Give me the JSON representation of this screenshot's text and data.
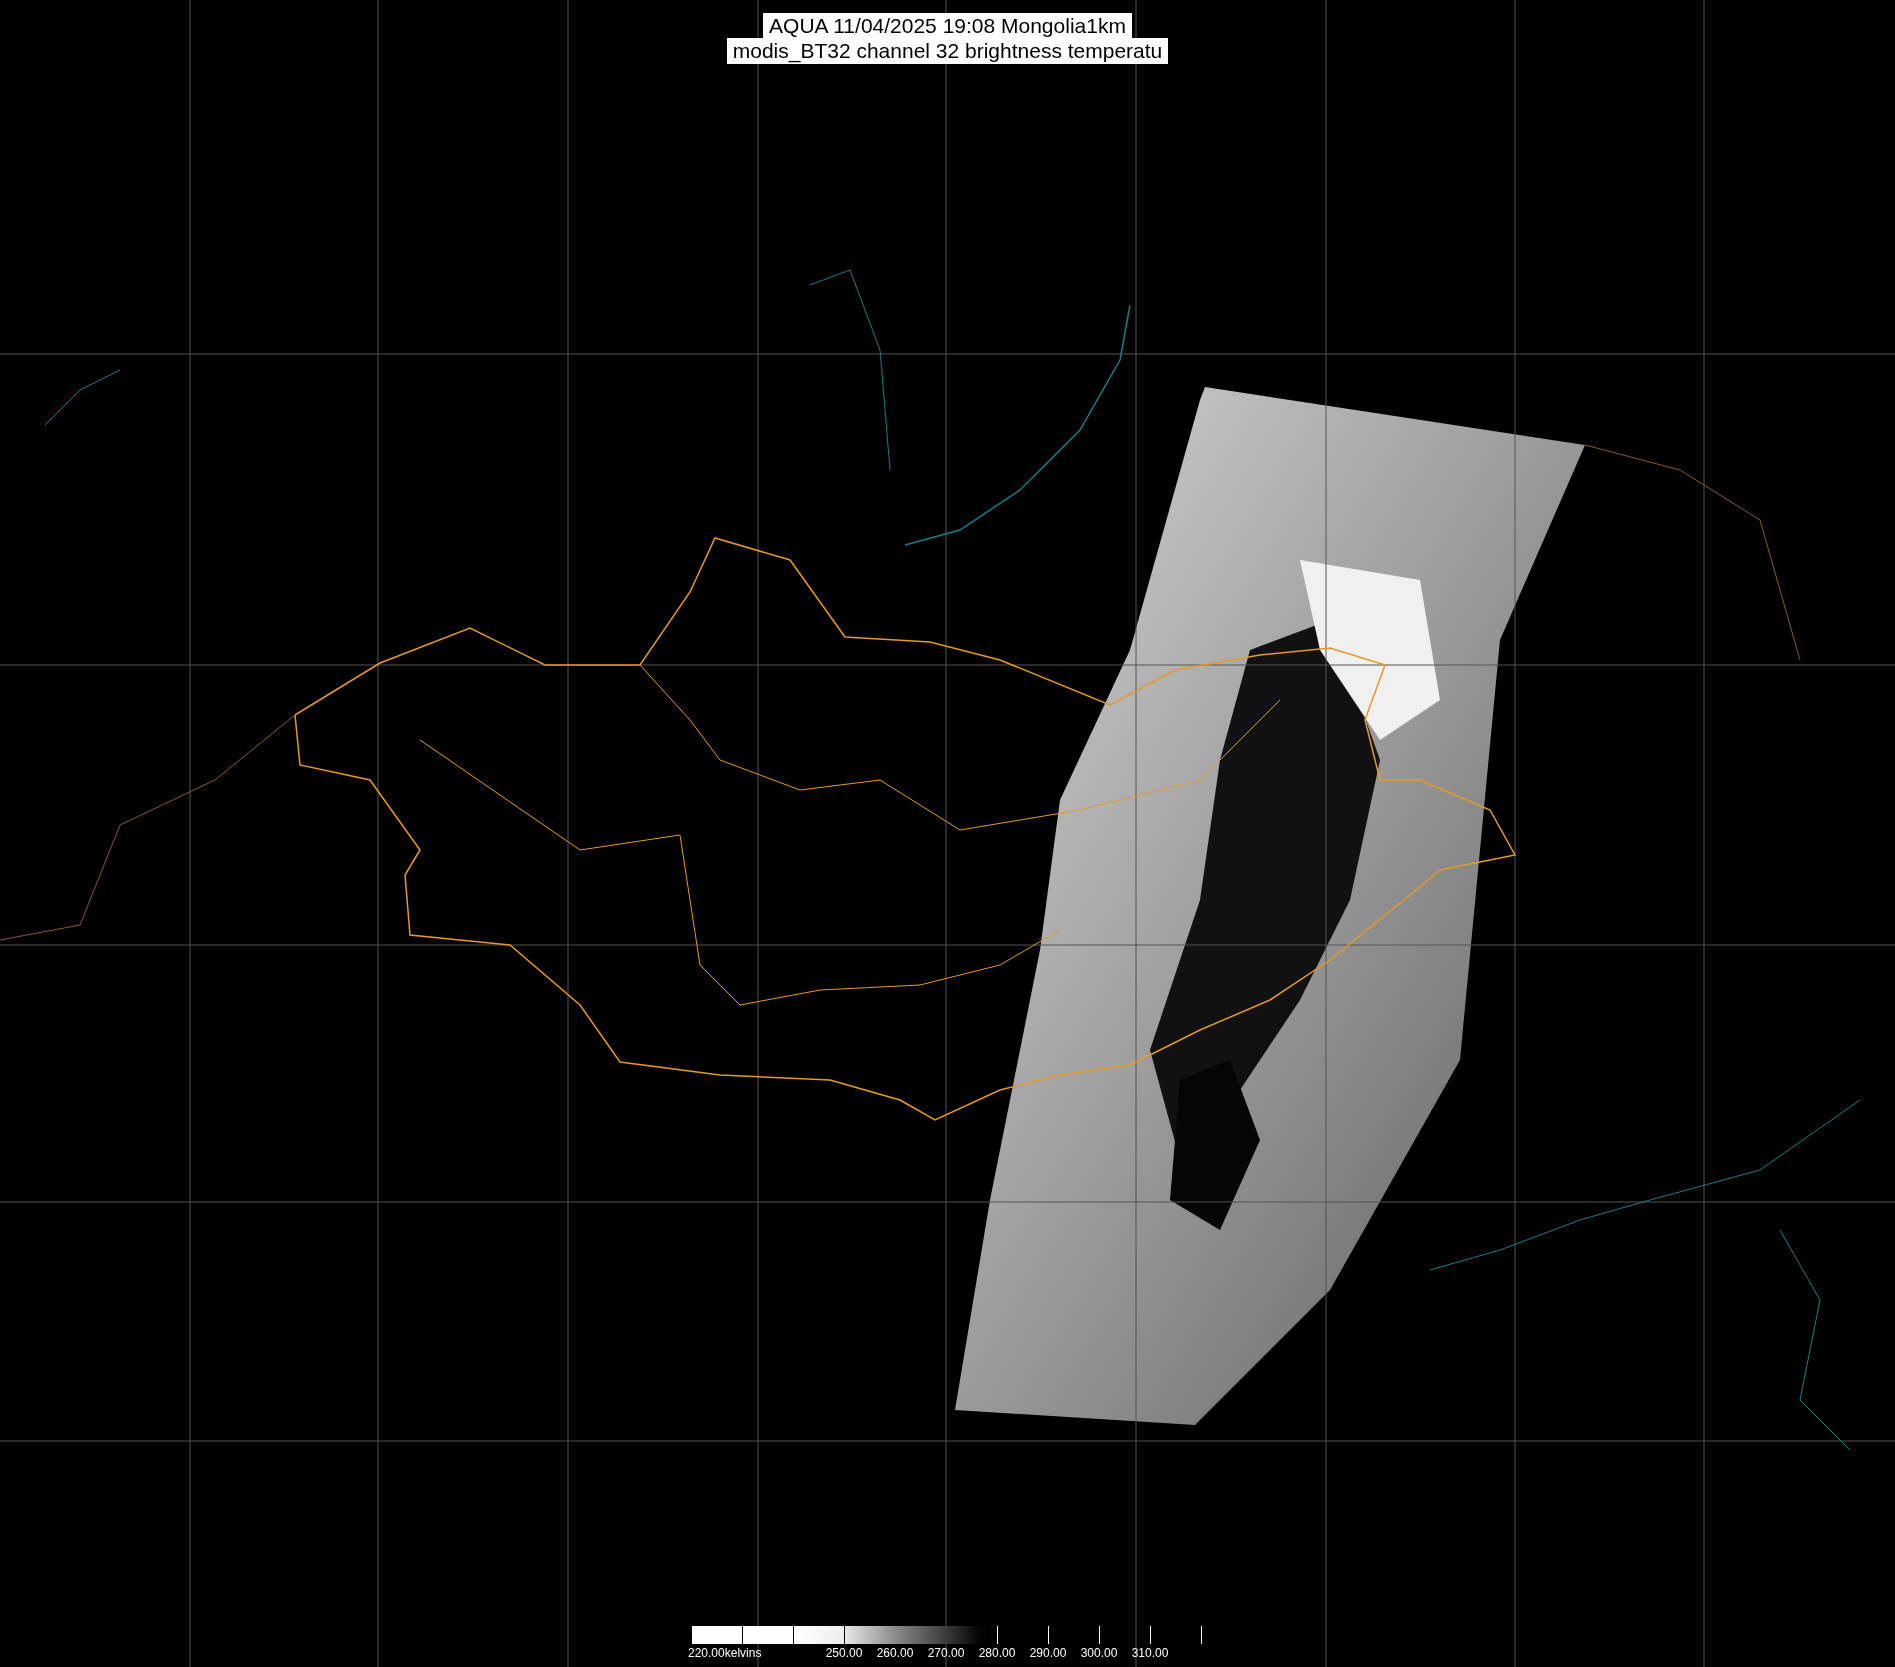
{
  "title": {
    "line_1": "AQUA 11/04/2025 19:08 Mongolia1km",
    "line_2": "modis_BT32 channel 32 brightness temperatu"
  },
  "colorbar": {
    "labels": [
      "220.00kelvins",
      "250.00",
      "260.00",
      "270.00",
      "280.00",
      "290.00",
      "300.00",
      "310.00"
    ]
  }
}
